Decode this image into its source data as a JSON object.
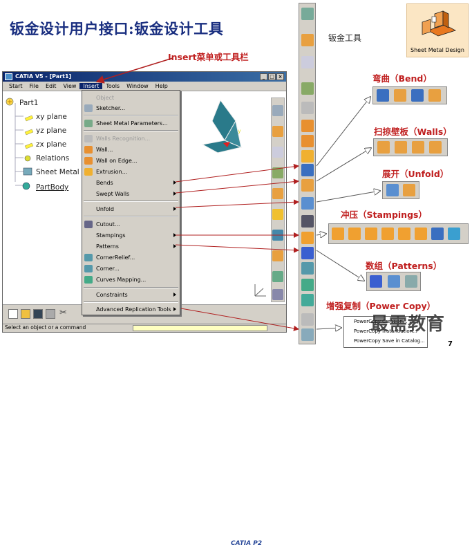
{
  "slide": {
    "title": "钣金设计用户接口:钣金设计工具",
    "insert_caption": "Insert菜单或工具栏",
    "sheet_metal_tools_label": "钣金工具",
    "page_number": "7",
    "watermark": "最需教育"
  },
  "window": {
    "title": "CATIA V5 - [Part1]",
    "buttons": [
      "_",
      "□",
      "×"
    ],
    "menus": [
      "Start",
      "File",
      "Edit",
      "View",
      "Insert",
      "Tools",
      "Window",
      "Help"
    ],
    "active_menu": "Insert",
    "status_text": "Select an object or a command",
    "logo": "CATIA P2"
  },
  "tree": {
    "root": "Part1",
    "items": [
      "xy plane",
      "yz plane",
      "zx plane",
      "Relations",
      "Sheet Metal Pa",
      "PartBody"
    ]
  },
  "insert_menu": {
    "items": [
      {
        "label": "Object",
        "disabled": true,
        "sub": false
      },
      {
        "label": "Sketcher...",
        "disabled": false,
        "sub": false
      },
      {
        "label": "Sheet Metal Parameters...",
        "disabled": false,
        "sub": false
      },
      {
        "label": "Walls Recognition...",
        "disabled": true,
        "sub": false
      },
      {
        "label": "Wall...",
        "disabled": false,
        "sub": false
      },
      {
        "label": "Wall on Edge...",
        "disabled": false,
        "sub": false
      },
      {
        "label": "Extrusion...",
        "disabled": false,
        "sub": false
      },
      {
        "label": "Bends",
        "disabled": false,
        "sub": true
      },
      {
        "label": "Swept Walls",
        "disabled": false,
        "sub": true
      },
      {
        "label": "Unfold",
        "disabled": false,
        "sub": true
      },
      {
        "label": "Cutout...",
        "disabled": false,
        "sub": false
      },
      {
        "label": "Stampings",
        "disabled": false,
        "sub": true
      },
      {
        "label": "Patterns",
        "disabled": false,
        "sub": true
      },
      {
        "label": "CornerRelief...",
        "disabled": false,
        "sub": false
      },
      {
        "label": "Corner...",
        "disabled": false,
        "sub": false
      },
      {
        "label": "Curves Mapping...",
        "disabled": false,
        "sub": false
      },
      {
        "label": "Constraints",
        "disabled": false,
        "sub": true
      },
      {
        "label": "Advanced Replication Tools",
        "disabled": false,
        "sub": true
      }
    ]
  },
  "toolbars": {
    "logo_caption": "Sheet Metal Design",
    "bend": "弯曲（Bend）",
    "walls": "扫掠壁板（Walls）",
    "unfold": "展开（Unfold）",
    "stampings": "冲压（Stampings）",
    "patterns": "数组（Patterns）",
    "power_copy": "增强复制（Power Copy）"
  },
  "power_copy_menu": [
    "PowerCopy Creation...",
    "PowerCopy Instantiation...",
    "PowerCopy Save in Catalog..."
  ],
  "colors": {
    "title": "#1a2f80",
    "label_red": "#c02020",
    "arrow": "#b02020",
    "menu_bg": "#d4d0c8",
    "tree_bg": "#ffffff"
  }
}
